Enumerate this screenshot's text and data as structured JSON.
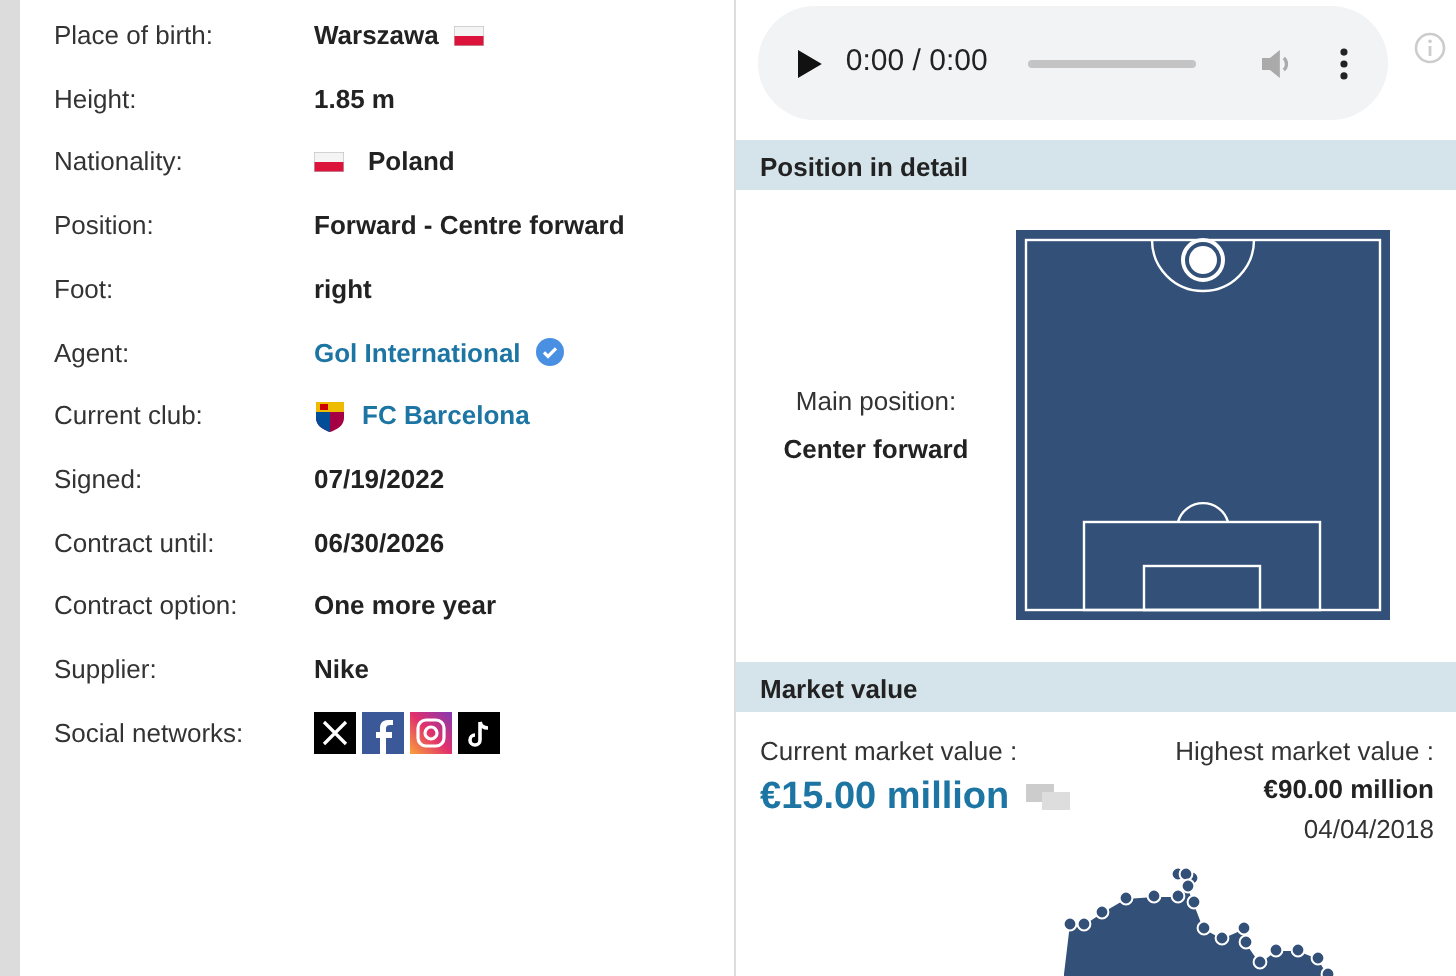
{
  "details": [
    {
      "label": "Place of birth:",
      "value": "Warszawa",
      "kind": "flag-after"
    },
    {
      "label": "Height:",
      "value": "1.85 m",
      "kind": "text"
    },
    {
      "label": "Nationality:",
      "value": "Poland",
      "kind": "flag-before"
    },
    {
      "label": "Position:",
      "value": "Forward - Centre forward",
      "kind": "text"
    },
    {
      "label": "Foot:",
      "value": "right",
      "kind": "text"
    },
    {
      "label": "Agent:",
      "value": "Gol International",
      "kind": "verified-link"
    },
    {
      "label": "Current club:",
      "value": "FC Barcelona",
      "kind": "club-link"
    },
    {
      "label": "Signed:",
      "value": "07/19/2022",
      "kind": "text"
    },
    {
      "label": "Contract until:",
      "value": "06/30/2026",
      "kind": "text"
    },
    {
      "label": "Contract option:",
      "value": "One more year",
      "kind": "text"
    },
    {
      "label": "Supplier:",
      "value": "Nike",
      "kind": "text"
    },
    {
      "label": "Social networks:",
      "kind": "social"
    }
  ],
  "audio": {
    "time": "0:00 / 0:00"
  },
  "position": {
    "header": "Position in detail",
    "label": "Main position:",
    "value": "Center forward"
  },
  "market_value": {
    "header": "Market value",
    "current_label": "Current market value :",
    "current_value": "€15.00 million",
    "highest_label": "Highest market value :",
    "highest_value": "€90.00 million",
    "highest_date": "04/04/2018"
  }
}
